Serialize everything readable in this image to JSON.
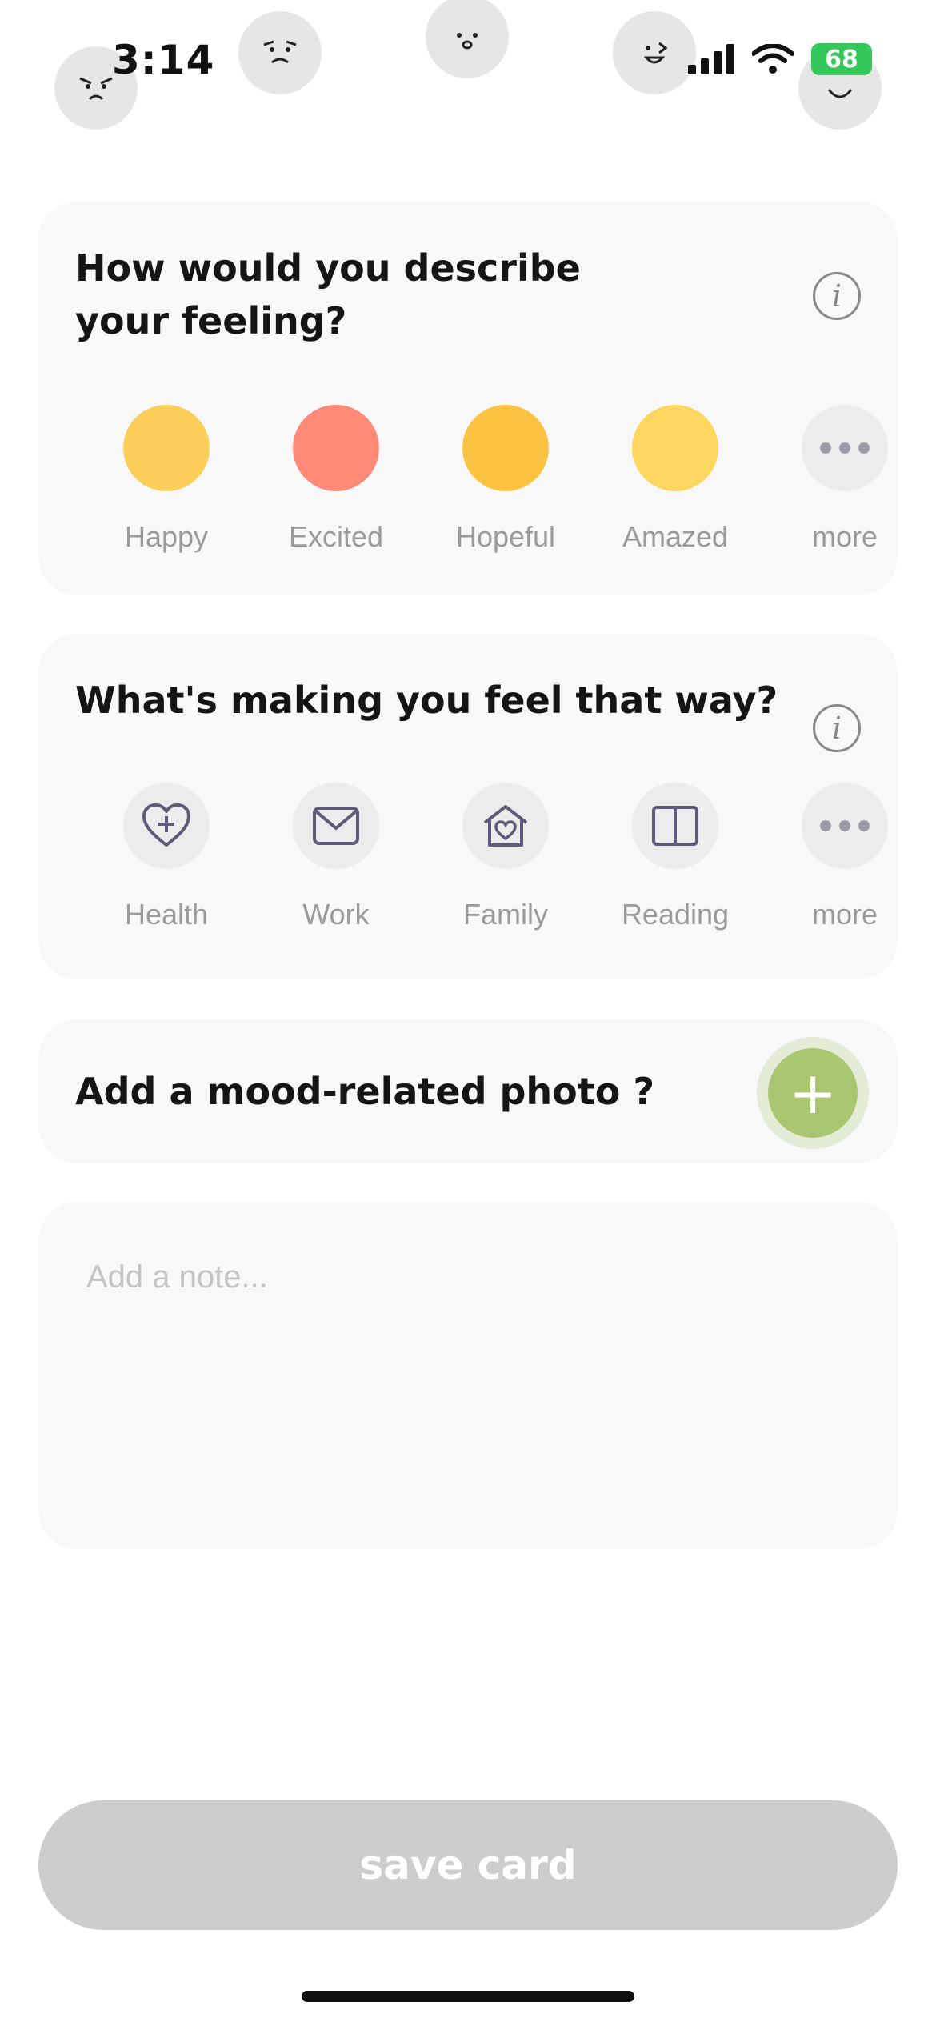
{
  "status_bar": {
    "time": "3:14",
    "battery": "68"
  },
  "feeling_card": {
    "title_line1": "How would you describe",
    "title_line2": "your feeling?",
    "info_glyph": "i",
    "options": [
      {
        "label": "Happy",
        "color": "#fbcf5a"
      },
      {
        "label": "Excited",
        "color": "#ff8a78"
      },
      {
        "label": "Hopeful",
        "color": "#fcc343"
      },
      {
        "label": "Amazed",
        "color": "#fed660"
      },
      {
        "label": "more",
        "icon": "more-dots-icon"
      }
    ]
  },
  "reason_card": {
    "title": "What's making you feel that way?",
    "info_glyph": "i",
    "options": [
      {
        "label": "Health",
        "icon": "heart-plus-icon"
      },
      {
        "label": "Work",
        "icon": "envelope-icon"
      },
      {
        "label": "Family",
        "icon": "house-heart-icon"
      },
      {
        "label": "Reading",
        "icon": "book-icon"
      },
      {
        "label": "more",
        "icon": "more-dots-icon"
      }
    ]
  },
  "photo_card": {
    "title": "Add a mood-related photo ?",
    "add_glyph": "+"
  },
  "note": {
    "placeholder": "Add a note..."
  },
  "save_button": {
    "label": "save card"
  },
  "colors": {
    "accent_green": "#a9c770",
    "card_bg": "#f8f8f8",
    "icon_stroke": "#5f5a7a"
  }
}
